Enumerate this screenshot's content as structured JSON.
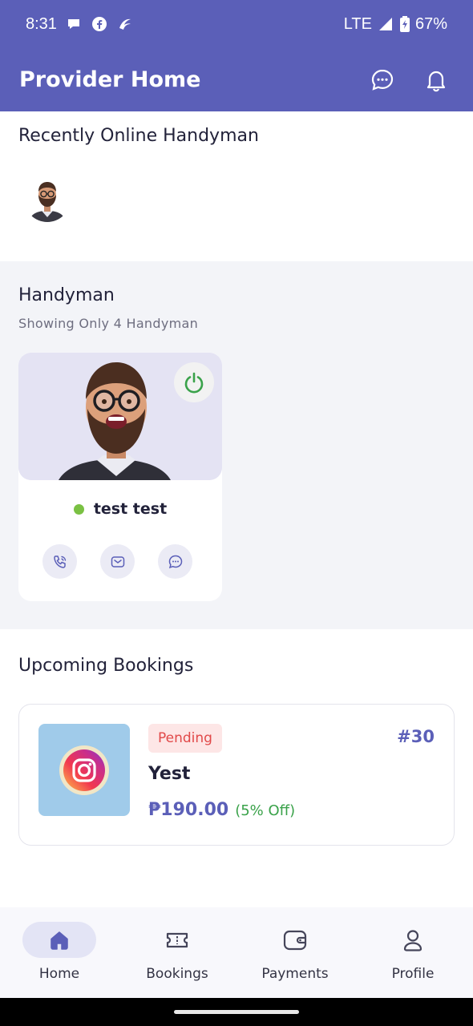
{
  "status_bar": {
    "time": "8:31",
    "network": "LTE",
    "battery": "67%",
    "left_icons": [
      "chat-bubble-icon",
      "facebook-icon",
      "app-swirl-icon"
    ]
  },
  "app_bar": {
    "title": "Provider Home",
    "actions": [
      "chat-icon",
      "bell-icon"
    ]
  },
  "recently_online": {
    "heading": "Recently Online Handyman"
  },
  "handyman": {
    "heading": "Handyman",
    "subtitle": "Showing Only 4 Handyman",
    "card": {
      "name": "test test",
      "online": true,
      "actions": [
        "phone-icon",
        "email-icon",
        "chat-icon"
      ]
    }
  },
  "upcoming": {
    "heading": "Upcoming Bookings",
    "booking": {
      "status": "Pending",
      "id": "#30",
      "title": "Yest",
      "price": "₱190.00",
      "discount": "(5% Off)"
    }
  },
  "bottom_nav": {
    "items": [
      {
        "label": "Home",
        "icon": "home-icon",
        "active": true
      },
      {
        "label": "Bookings",
        "icon": "ticket-icon",
        "active": false
      },
      {
        "label": "Payments",
        "icon": "wallet-icon",
        "active": false
      },
      {
        "label": "Profile",
        "icon": "user-icon",
        "active": false
      }
    ]
  },
  "colors": {
    "primary": "#5b5fb8",
    "pending_bg": "#fde6e6",
    "pending_text": "#e14949",
    "discount_text": "#3aa24a",
    "online_dot": "#7ac143"
  }
}
